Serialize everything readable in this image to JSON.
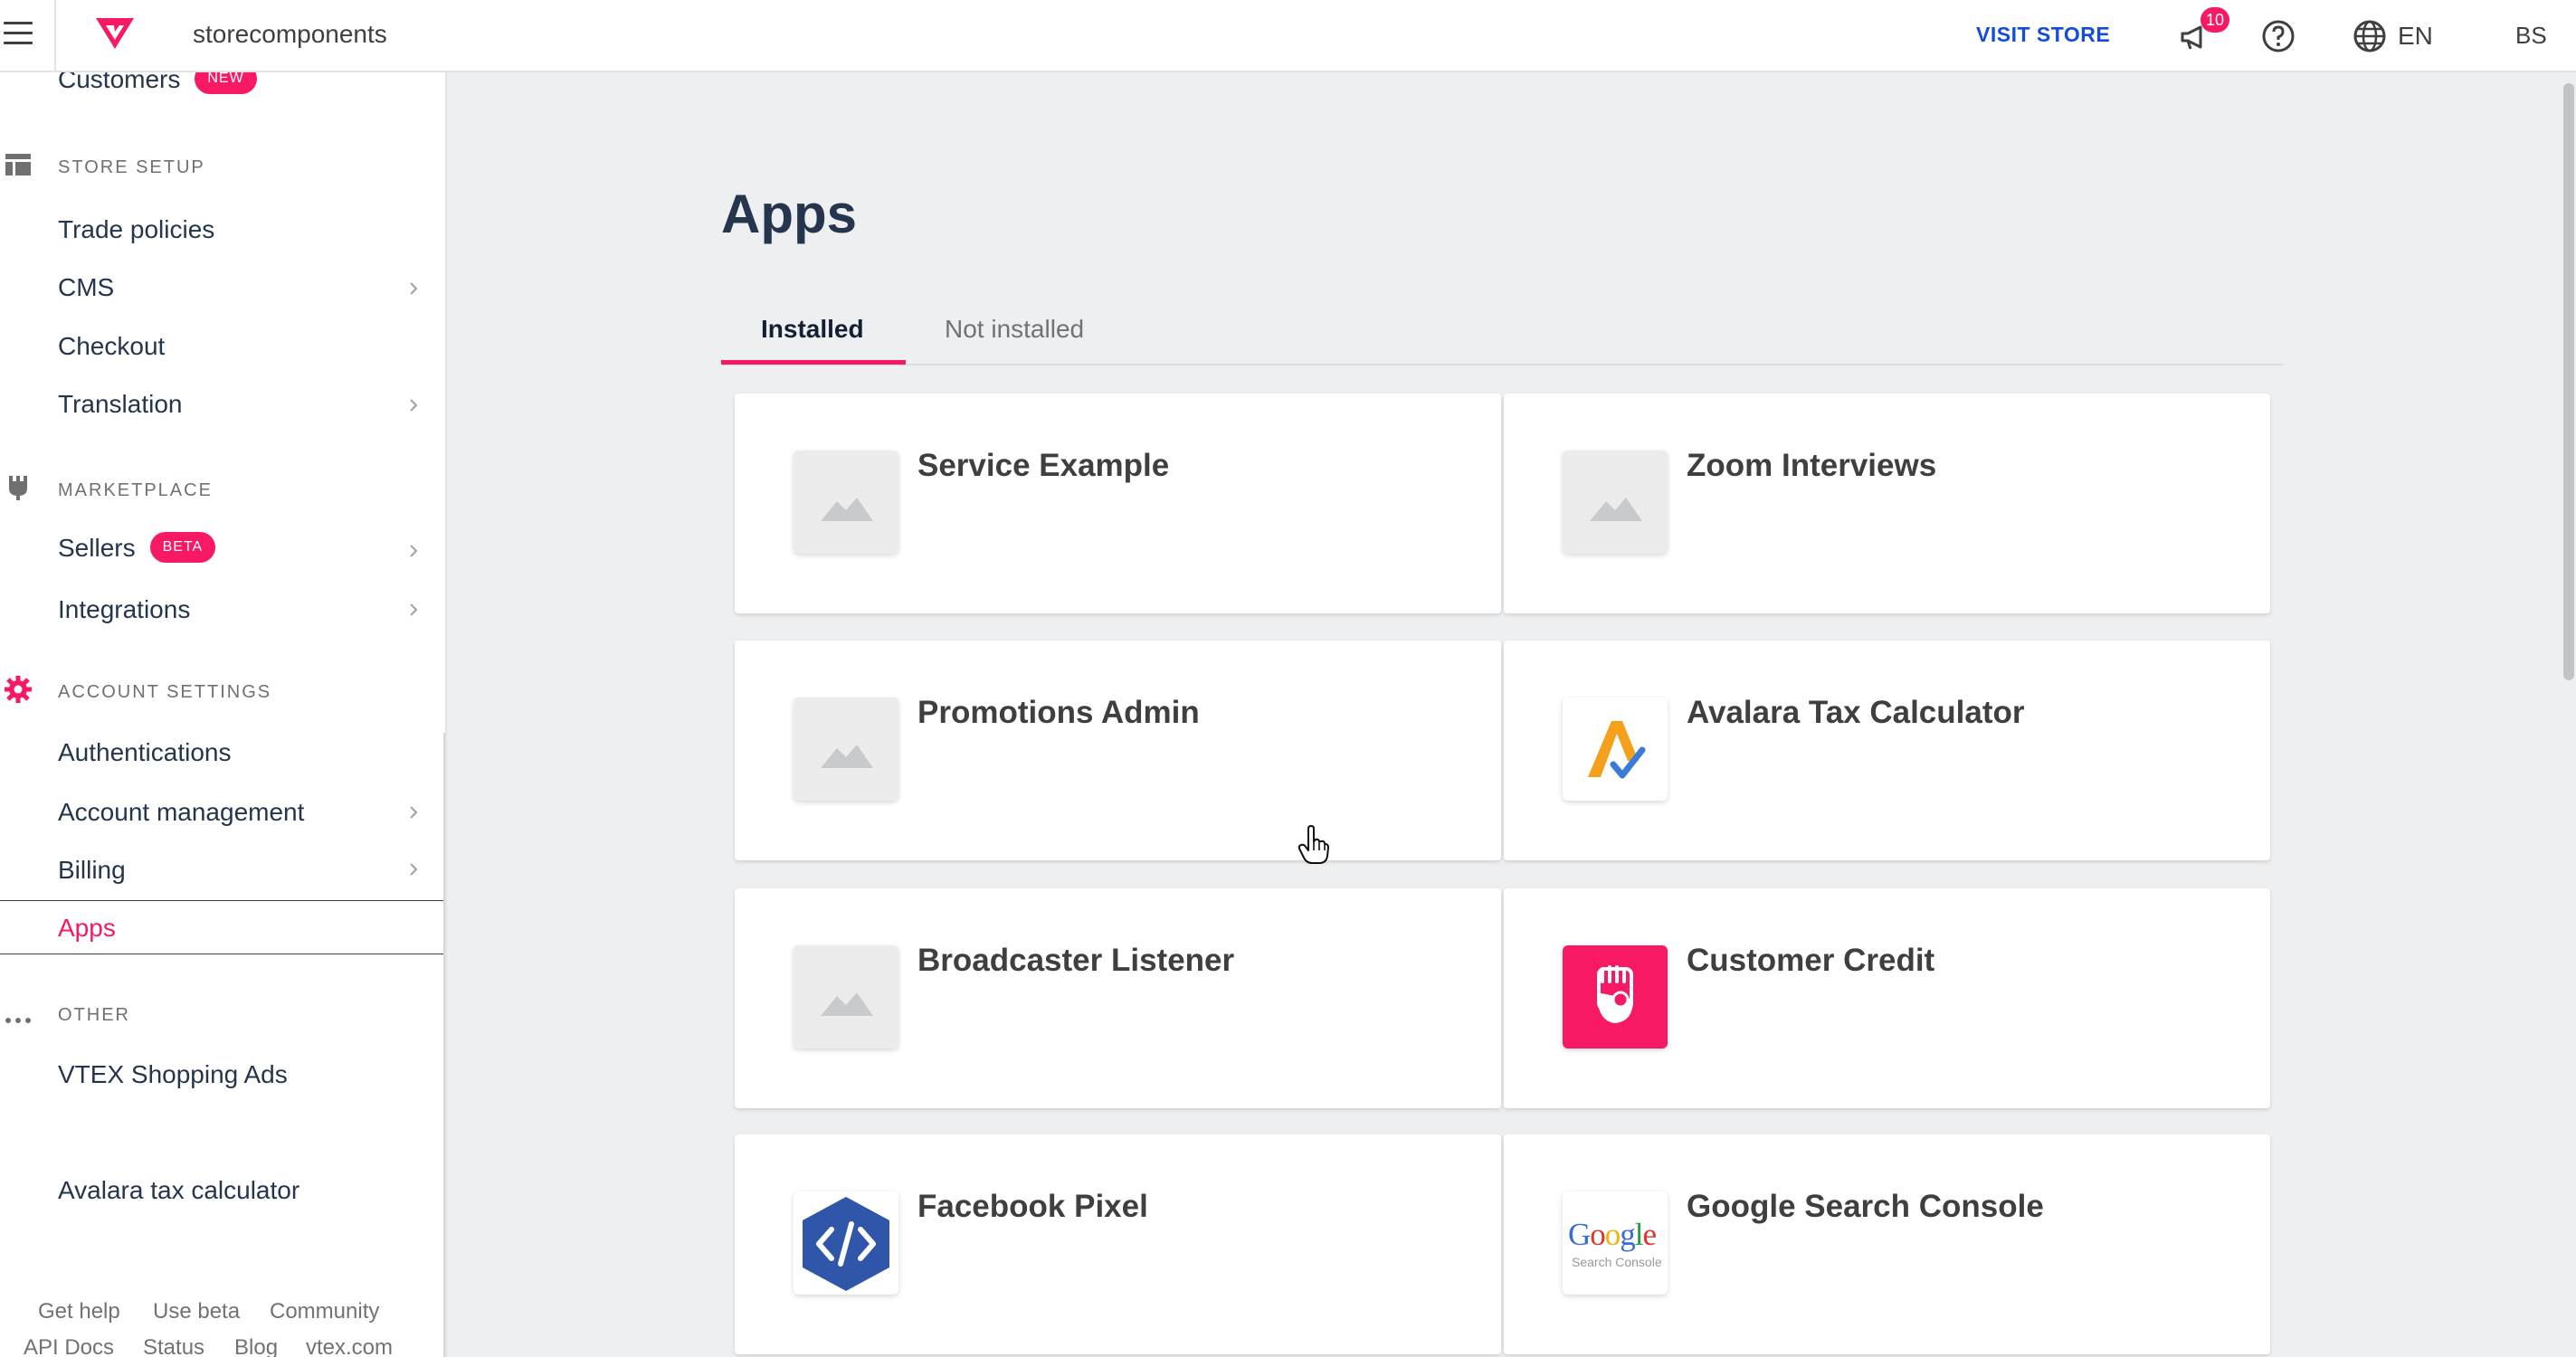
{
  "topbar": {
    "store_name": "storecomponents",
    "visit_store": "VISIT STORE",
    "notification_count": "10",
    "language": "EN",
    "user_initials": "BS",
    "brand_color": "#f71963",
    "link_color": "#134cd8"
  },
  "sidebar": {
    "customers": {
      "label": "Customers",
      "badge": "NEW"
    },
    "store_setup": {
      "header": "STORE SETUP",
      "items": [
        "Trade policies",
        "CMS",
        "Checkout",
        "Translation"
      ]
    },
    "marketplace": {
      "header": "MARKETPLACE",
      "sellers": {
        "label": "Sellers",
        "badge": "BETA"
      },
      "integrations": "Integrations"
    },
    "account_settings": {
      "header": "ACCOUNT SETTINGS",
      "items": [
        "Authentications",
        "Account management",
        "Billing",
        "Apps"
      ]
    },
    "other": {
      "header": "OTHER",
      "items": [
        "VTEX Shopping Ads",
        "Avalara tax calculator"
      ]
    },
    "footer": {
      "row1": [
        "Get help",
        "Use beta",
        "Community"
      ],
      "row2": [
        "API Docs",
        "Status",
        "Blog",
        "vtex.com"
      ]
    }
  },
  "main": {
    "title": "Apps",
    "tabs": [
      "Installed",
      "Not installed"
    ],
    "active_tab": "Installed",
    "apps": [
      {
        "name": "Service Example",
        "icon": "placeholder-image-icon"
      },
      {
        "name": "Zoom Interviews",
        "icon": "placeholder-image-icon"
      },
      {
        "name": "Promotions Admin",
        "icon": "placeholder-image-icon"
      },
      {
        "name": "Avalara Tax Calculator",
        "icon": "avalara-logo-icon"
      },
      {
        "name": "Broadcaster Listener",
        "icon": "placeholder-image-icon"
      },
      {
        "name": "Customer Credit",
        "icon": "customer-credit-icon"
      },
      {
        "name": "Facebook Pixel",
        "icon": "code-hexagon-icon"
      },
      {
        "name": "Google Search Console",
        "icon": "google-search-console-icon"
      }
    ],
    "google_logo_text": "Google",
    "google_logo_sub": "Search Console"
  }
}
